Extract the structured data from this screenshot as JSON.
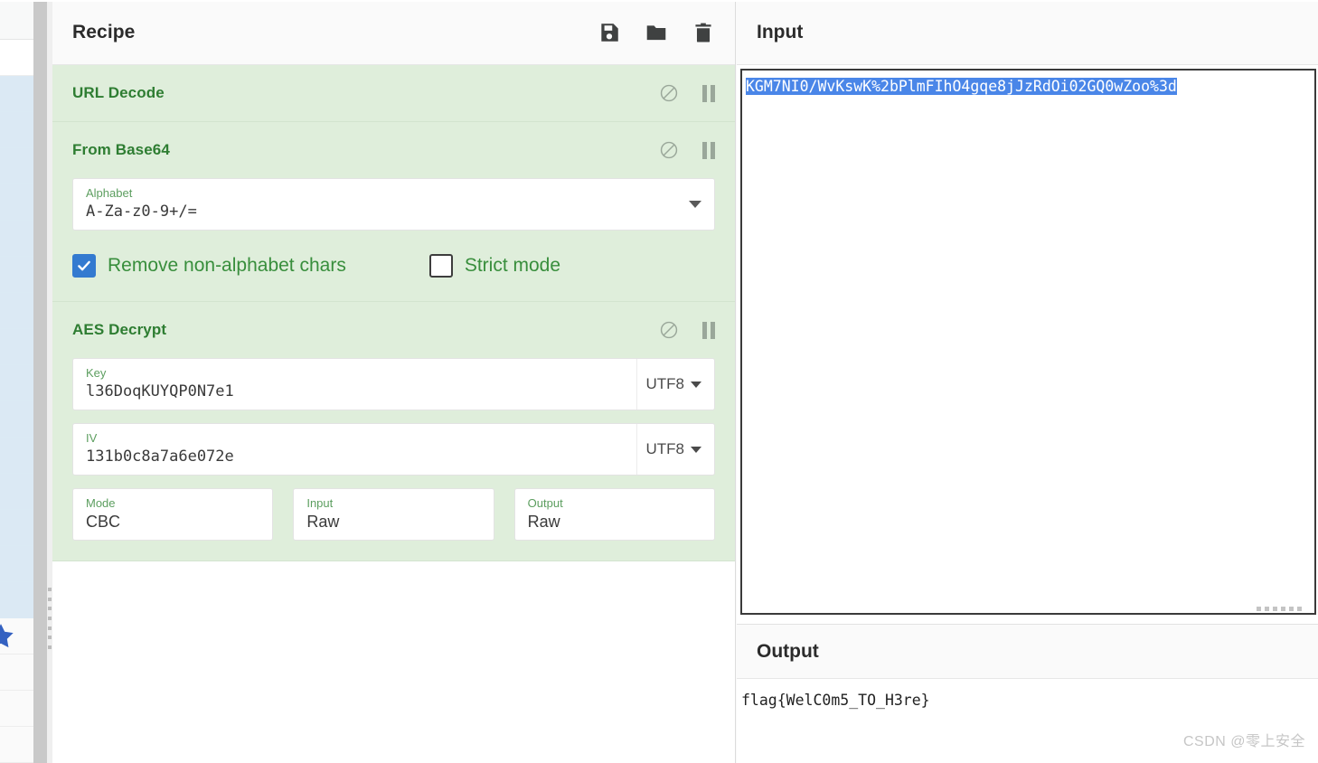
{
  "colors": {
    "op_background": "#dfeedb",
    "op_title": "#2e7d32",
    "label_green": "#5c9e5f",
    "checkbox_checked": "#337ad0",
    "selection_blue": "#4a86e8",
    "panel_header": "#fafafa"
  },
  "recipe": {
    "title": "Recipe",
    "actions": [
      {
        "name": "save-recipe",
        "icon": "save-icon",
        "label": "Save recipe"
      },
      {
        "name": "load-recipe",
        "icon": "folder-icon",
        "label": "Load recipe"
      },
      {
        "name": "clear-recipe",
        "icon": "trash-icon",
        "label": "Clear recipe"
      }
    ],
    "operations": [
      {
        "name": "URL Decode",
        "disable_icon": "disable-icon",
        "pause_icon": "pause-icon",
        "args": []
      },
      {
        "name": "From Base64",
        "disable_icon": "disable-icon",
        "pause_icon": "pause-icon",
        "alphabet": {
          "label": "Alphabet",
          "value": "A-Za-z0-9+/="
        },
        "checkboxes": [
          {
            "label": "Remove non-alphabet chars",
            "checked": true
          },
          {
            "label": "Strict mode",
            "checked": false
          }
        ]
      },
      {
        "name": "AES Decrypt",
        "disable_icon": "disable-icon",
        "pause_icon": "pause-icon",
        "key": {
          "label": "Key",
          "value": "l36DoqKUYQP0N7e1",
          "encoding": "UTF8"
        },
        "iv": {
          "label": "IV",
          "value": "131b0c8a7a6e072e",
          "encoding": "UTF8"
        },
        "mode": {
          "label": "Mode",
          "value": "CBC"
        },
        "input": {
          "label": "Input",
          "value": "Raw"
        },
        "output": {
          "label": "Output",
          "value": "Raw"
        }
      }
    ]
  },
  "input_panel": {
    "title": "Input",
    "value": "KGM7NI0/WvKswK%2bPlmFIhO4gqe8jJzRdOi02GQ0wZoo%3d",
    "selected": true
  },
  "output_panel": {
    "title": "Output",
    "value": "flag{WelC0m5_TO_H3re}"
  },
  "watermark": "CSDN @零上安全"
}
